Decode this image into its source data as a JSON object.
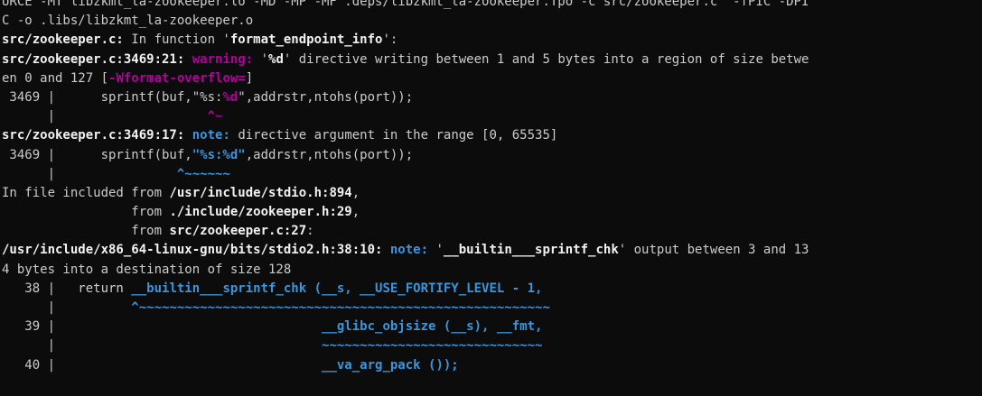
{
  "terminal": {
    "lines": [
      {
        "segments": [
          {
            "text": "URCE -MT libzkmt_la-zookeeper.lo -MD -MP -MF .deps/libzkmt_la-zookeeper.Tpo -c src/zookeeper.c  -fPIC -DPI",
            "style": ""
          }
        ]
      },
      {
        "segments": [
          {
            "text": "C -o .libs/libzkmt_la-zookeeper.o",
            "style": ""
          }
        ]
      },
      {
        "segments": [
          {
            "text": "src/zookeeper.c:",
            "style": "b"
          },
          {
            "text": " In function '",
            "style": ""
          },
          {
            "text": "format_endpoint_info",
            "style": "b"
          },
          {
            "text": "':",
            "style": ""
          }
        ]
      },
      {
        "segments": [
          {
            "text": "src/zookeeper.c:3469:21:",
            "style": "b"
          },
          {
            "text": " ",
            "style": ""
          },
          {
            "text": "warning:",
            "style": "warn"
          },
          {
            "text": " '",
            "style": ""
          },
          {
            "text": "%d",
            "style": "b"
          },
          {
            "text": "' directive writing between 1 and 5 bytes into a region of size betwe",
            "style": ""
          }
        ]
      },
      {
        "segments": [
          {
            "text": "en 0 and 127 [",
            "style": ""
          },
          {
            "text": "-Wformat-overflow=",
            "style": "warn"
          },
          {
            "text": "]",
            "style": ""
          }
        ]
      },
      {
        "segments": [
          {
            "text": " 3469 |      sprintf(buf,\"%s:",
            "style": ""
          },
          {
            "text": "%d",
            "style": "hl-warn"
          },
          {
            "text": "\",addrstr,ntohs(port));",
            "style": ""
          }
        ]
      },
      {
        "segments": [
          {
            "text": "      |                    ",
            "style": ""
          },
          {
            "text": "^~",
            "style": "caret-warn"
          }
        ]
      },
      {
        "segments": [
          {
            "text": "src/zookeeper.c:3469:17:",
            "style": "b"
          },
          {
            "text": " ",
            "style": ""
          },
          {
            "text": "note:",
            "style": "note"
          },
          {
            "text": " directive argument in the range [0, 65535]",
            "style": ""
          }
        ]
      },
      {
        "segments": [
          {
            "text": " 3469 |      sprintf(buf,",
            "style": ""
          },
          {
            "text": "\"%s:%d\"",
            "style": "hl-note"
          },
          {
            "text": ",addrstr,ntohs(port));",
            "style": ""
          }
        ]
      },
      {
        "segments": [
          {
            "text": "      |                ",
            "style": ""
          },
          {
            "text": "^~~~~~~",
            "style": "caret-note"
          }
        ]
      },
      {
        "segments": [
          {
            "text": "In file included from ",
            "style": ""
          },
          {
            "text": "/usr/include/stdio.h:894",
            "style": "b"
          },
          {
            "text": ",",
            "style": ""
          }
        ]
      },
      {
        "segments": [
          {
            "text": "                 from ",
            "style": ""
          },
          {
            "text": "./include/zookeeper.h:29",
            "style": "b"
          },
          {
            "text": ",",
            "style": ""
          }
        ]
      },
      {
        "segments": [
          {
            "text": "                 from ",
            "style": ""
          },
          {
            "text": "src/zookeeper.c:27",
            "style": "b"
          },
          {
            "text": ":",
            "style": ""
          }
        ]
      },
      {
        "segments": [
          {
            "text": "/usr/include/x86_64-linux-gnu/bits/stdio2.h:38:10:",
            "style": "b"
          },
          {
            "text": " ",
            "style": ""
          },
          {
            "text": "note:",
            "style": "note"
          },
          {
            "text": " '",
            "style": ""
          },
          {
            "text": "__builtin___sprintf_chk",
            "style": "b"
          },
          {
            "text": "' output between 3 and 13",
            "style": ""
          }
        ]
      },
      {
        "segments": [
          {
            "text": "4 bytes into a destination of size 128",
            "style": ""
          }
        ]
      },
      {
        "segments": [
          {
            "text": "   38 |   return ",
            "style": ""
          },
          {
            "text": "__builtin___sprintf_chk (__s, __USE_FORTIFY_LEVEL - 1,",
            "style": "hl-note"
          }
        ]
      },
      {
        "segments": [
          {
            "text": "      |          ",
            "style": ""
          },
          {
            "text": "^~~~~~~~~~~~~~~~~~~~~~~~~~~~~~~~~~~~~~~~~~~~~~~~~~~~~~~",
            "style": "caret-note"
          }
        ]
      },
      {
        "segments": [
          {
            "text": "   39 |                                   ",
            "style": ""
          },
          {
            "text": "__glibc_objsize (__s), __fmt,",
            "style": "hl-note"
          }
        ]
      },
      {
        "segments": [
          {
            "text": "      |                                   ",
            "style": ""
          },
          {
            "text": "~~~~~~~~~~~~~~~~~~~~~~~~~~~~~",
            "style": "caret-note"
          }
        ]
      },
      {
        "segments": [
          {
            "text": "   40 |                                   ",
            "style": ""
          },
          {
            "text": "__va_arg_pack ());",
            "style": "hl-note"
          }
        ]
      }
    ]
  }
}
